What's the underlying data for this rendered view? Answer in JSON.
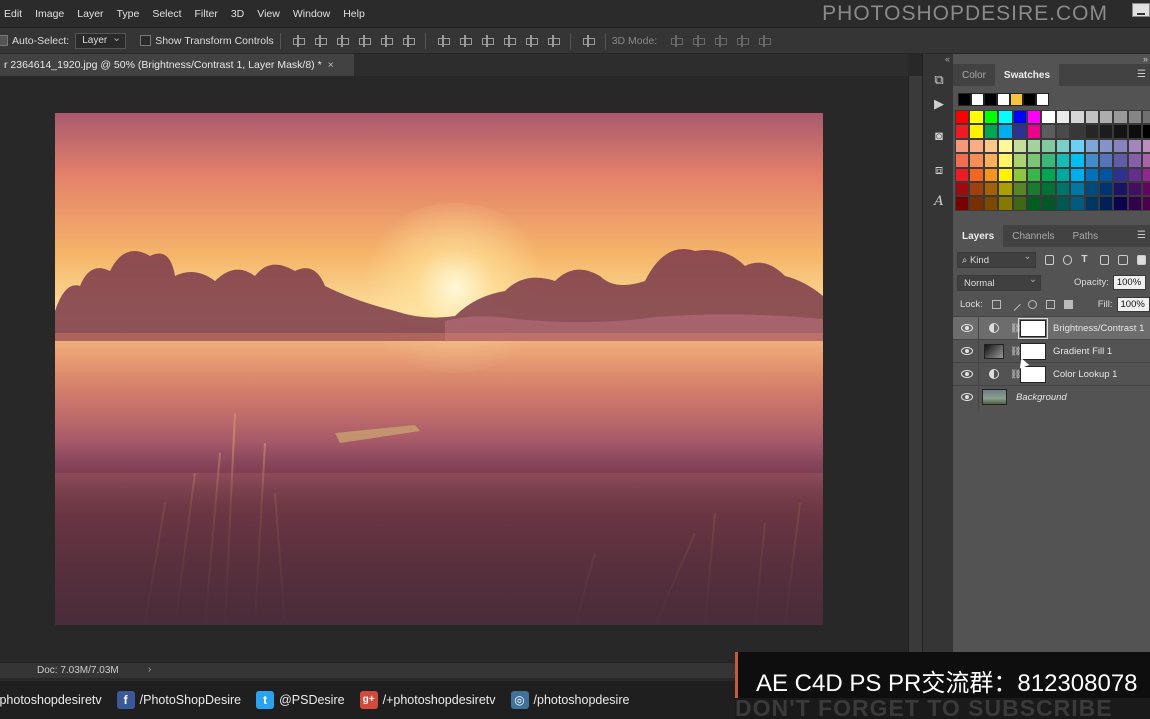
{
  "menu": [
    "Edit",
    "Image",
    "Layer",
    "Type",
    "Select",
    "Filter",
    "3D",
    "View",
    "Window",
    "Help"
  ],
  "brand": "PHOTOSHOPDESIRE.COM",
  "options": {
    "auto_select_label": "Auto-Select:",
    "auto_select_value": "Layer",
    "transform_label": "Show Transform Controls",
    "mode_3d_label": "3D Mode:"
  },
  "document": {
    "tab_title": "r 2364614_1920.jpg @ 50% (Brightness/Contrast 1, Layer Mask/8) *",
    "close": "×",
    "doc_size": "Doc: 7.03M/7.03M",
    "chevron": "›"
  },
  "swatch_panel": {
    "tabs": [
      "Color",
      "Swatches"
    ],
    "active_tab": "Swatches",
    "recent": [
      "#000000",
      "#ffffff",
      "#000000",
      "#ffffff",
      "#f6c33b",
      "#000000",
      "#ffffff"
    ],
    "grid": [
      [
        "#ff0000",
        "#ffff00",
        "#00ff00",
        "#00ffff",
        "#0000ff",
        "#ff00ff",
        "#ffffff",
        "#ebebeb",
        "#d6d6d6",
        "#c2c2c2",
        "#adadad",
        "#999999",
        "#858585",
        "#707070"
      ],
      [
        "#ed1c24",
        "#fff200",
        "#00a651",
        "#00aeef",
        "#2e3192",
        "#ec008c",
        "#5c5c5c",
        "#4a4a4a",
        "#383838",
        "#262626",
        "#1c1c1c",
        "#141414",
        "#0d0d0d",
        "#000000"
      ],
      [
        "#f7977a",
        "#f9ad81",
        "#fdc68a",
        "#fff79a",
        "#c4df9b",
        "#a3d39c",
        "#82ca9d",
        "#7bcdc8",
        "#6ecff6",
        "#7ea7d8",
        "#8493ca",
        "#8882be",
        "#a187be",
        "#bc8dbf"
      ],
      [
        "#f26c4f",
        "#f68e55",
        "#fbaf5c",
        "#fff467",
        "#acd372",
        "#7cc576",
        "#3bb878",
        "#1abbb4",
        "#00bff3",
        "#438ccb",
        "#5574b9",
        "#605ca8",
        "#855fa8",
        "#a763a8"
      ],
      [
        "#ed1c24",
        "#f26522",
        "#f7941d",
        "#fff200",
        "#8dc63f",
        "#39b54a",
        "#00a651",
        "#00a99d",
        "#00aeef",
        "#0072bc",
        "#0054a6",
        "#2e3192",
        "#662d91",
        "#92278f"
      ],
      [
        "#9e0b0f",
        "#a0410d",
        "#a36209",
        "#aba000",
        "#598527",
        "#1a7b30",
        "#007236",
        "#00746b",
        "#0076a3",
        "#004a80",
        "#003471",
        "#1b1464",
        "#440e62",
        "#630460"
      ],
      [
        "#790000",
        "#7b2e00",
        "#7d4900",
        "#827b00",
        "#406618",
        "#005e20",
        "#005826",
        "#005952",
        "#005b7f",
        "#003663",
        "#002157",
        "#0d004c",
        "#32004b",
        "#4b0049"
      ]
    ]
  },
  "layers_panel": {
    "tabs": [
      "Layers",
      "Channels",
      "Paths"
    ],
    "active_tab": "Layers",
    "kind": "Kind",
    "blend_mode": "Normal",
    "opacity_label": "Opacity:",
    "opacity_value": "100%",
    "lock_label": "Lock:",
    "fill_label": "Fill:",
    "fill_value": "100%",
    "layers": [
      {
        "name": "Brightness/Contrast 1",
        "type": "adjustment",
        "selected": true
      },
      {
        "name": "Gradient Fill 1",
        "type": "gradient",
        "selected": false
      },
      {
        "name": "Color Lookup 1",
        "type": "adjustment",
        "selected": false
      },
      {
        "name": "Background",
        "type": "background",
        "selected": false
      }
    ]
  },
  "social": {
    "youtube": "/photoshopdesiretv",
    "facebook": "/PhotoShopDesire",
    "twitter": "@PSDesire",
    "googleplus": "/+photoshopdesiretv",
    "instagram": "/photoshopdesire",
    "fb_icon": "f",
    "tw_icon": "t",
    "gp_icon": "g+",
    "ig_icon": "◎"
  },
  "overlay": {
    "text": "AE C4D PS PR交流群：812308078",
    "subscribe": "DON'T FORGET TO SUBSCRIBE"
  }
}
